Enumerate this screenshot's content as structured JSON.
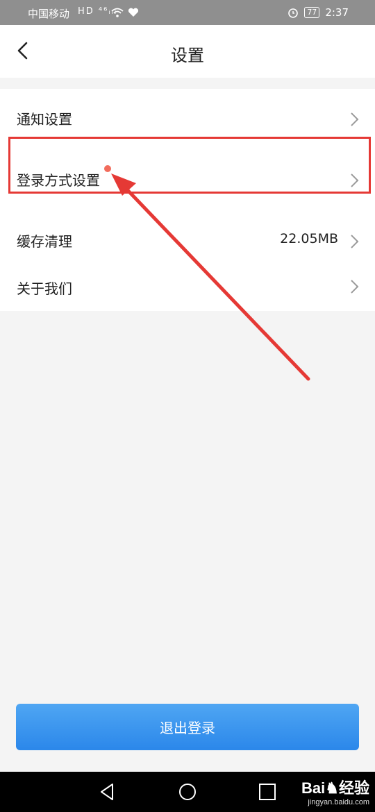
{
  "status_bar": {
    "carrier": "中国移动",
    "network_icons": "HD ⁴⁶ᵢₗₗ",
    "battery": "77",
    "time": "2:37"
  },
  "header": {
    "title": "设置"
  },
  "settings": {
    "items": [
      {
        "label": "通知设置",
        "value": ""
      },
      {
        "label": "登录方式设置",
        "value": ""
      },
      {
        "label": "缓存清理",
        "value": "22.05MB"
      },
      {
        "label": "关于我们",
        "value": ""
      }
    ]
  },
  "logout_label": "退出登录",
  "watermark": {
    "brand": "Bai♞经验",
    "url": "jingyan.baidu.com"
  },
  "colors": {
    "accent_button": "#2b87ea",
    "annotation_red": "#e53935",
    "badge_dot": "#f26c5c"
  },
  "icons": [
    "back-arrow-icon",
    "chevron-right-icon",
    "nav-back-icon",
    "nav-home-icon",
    "nav-recents-icon",
    "alarm-icon",
    "battery-icon",
    "wifi-icon",
    "signal-icon"
  ]
}
